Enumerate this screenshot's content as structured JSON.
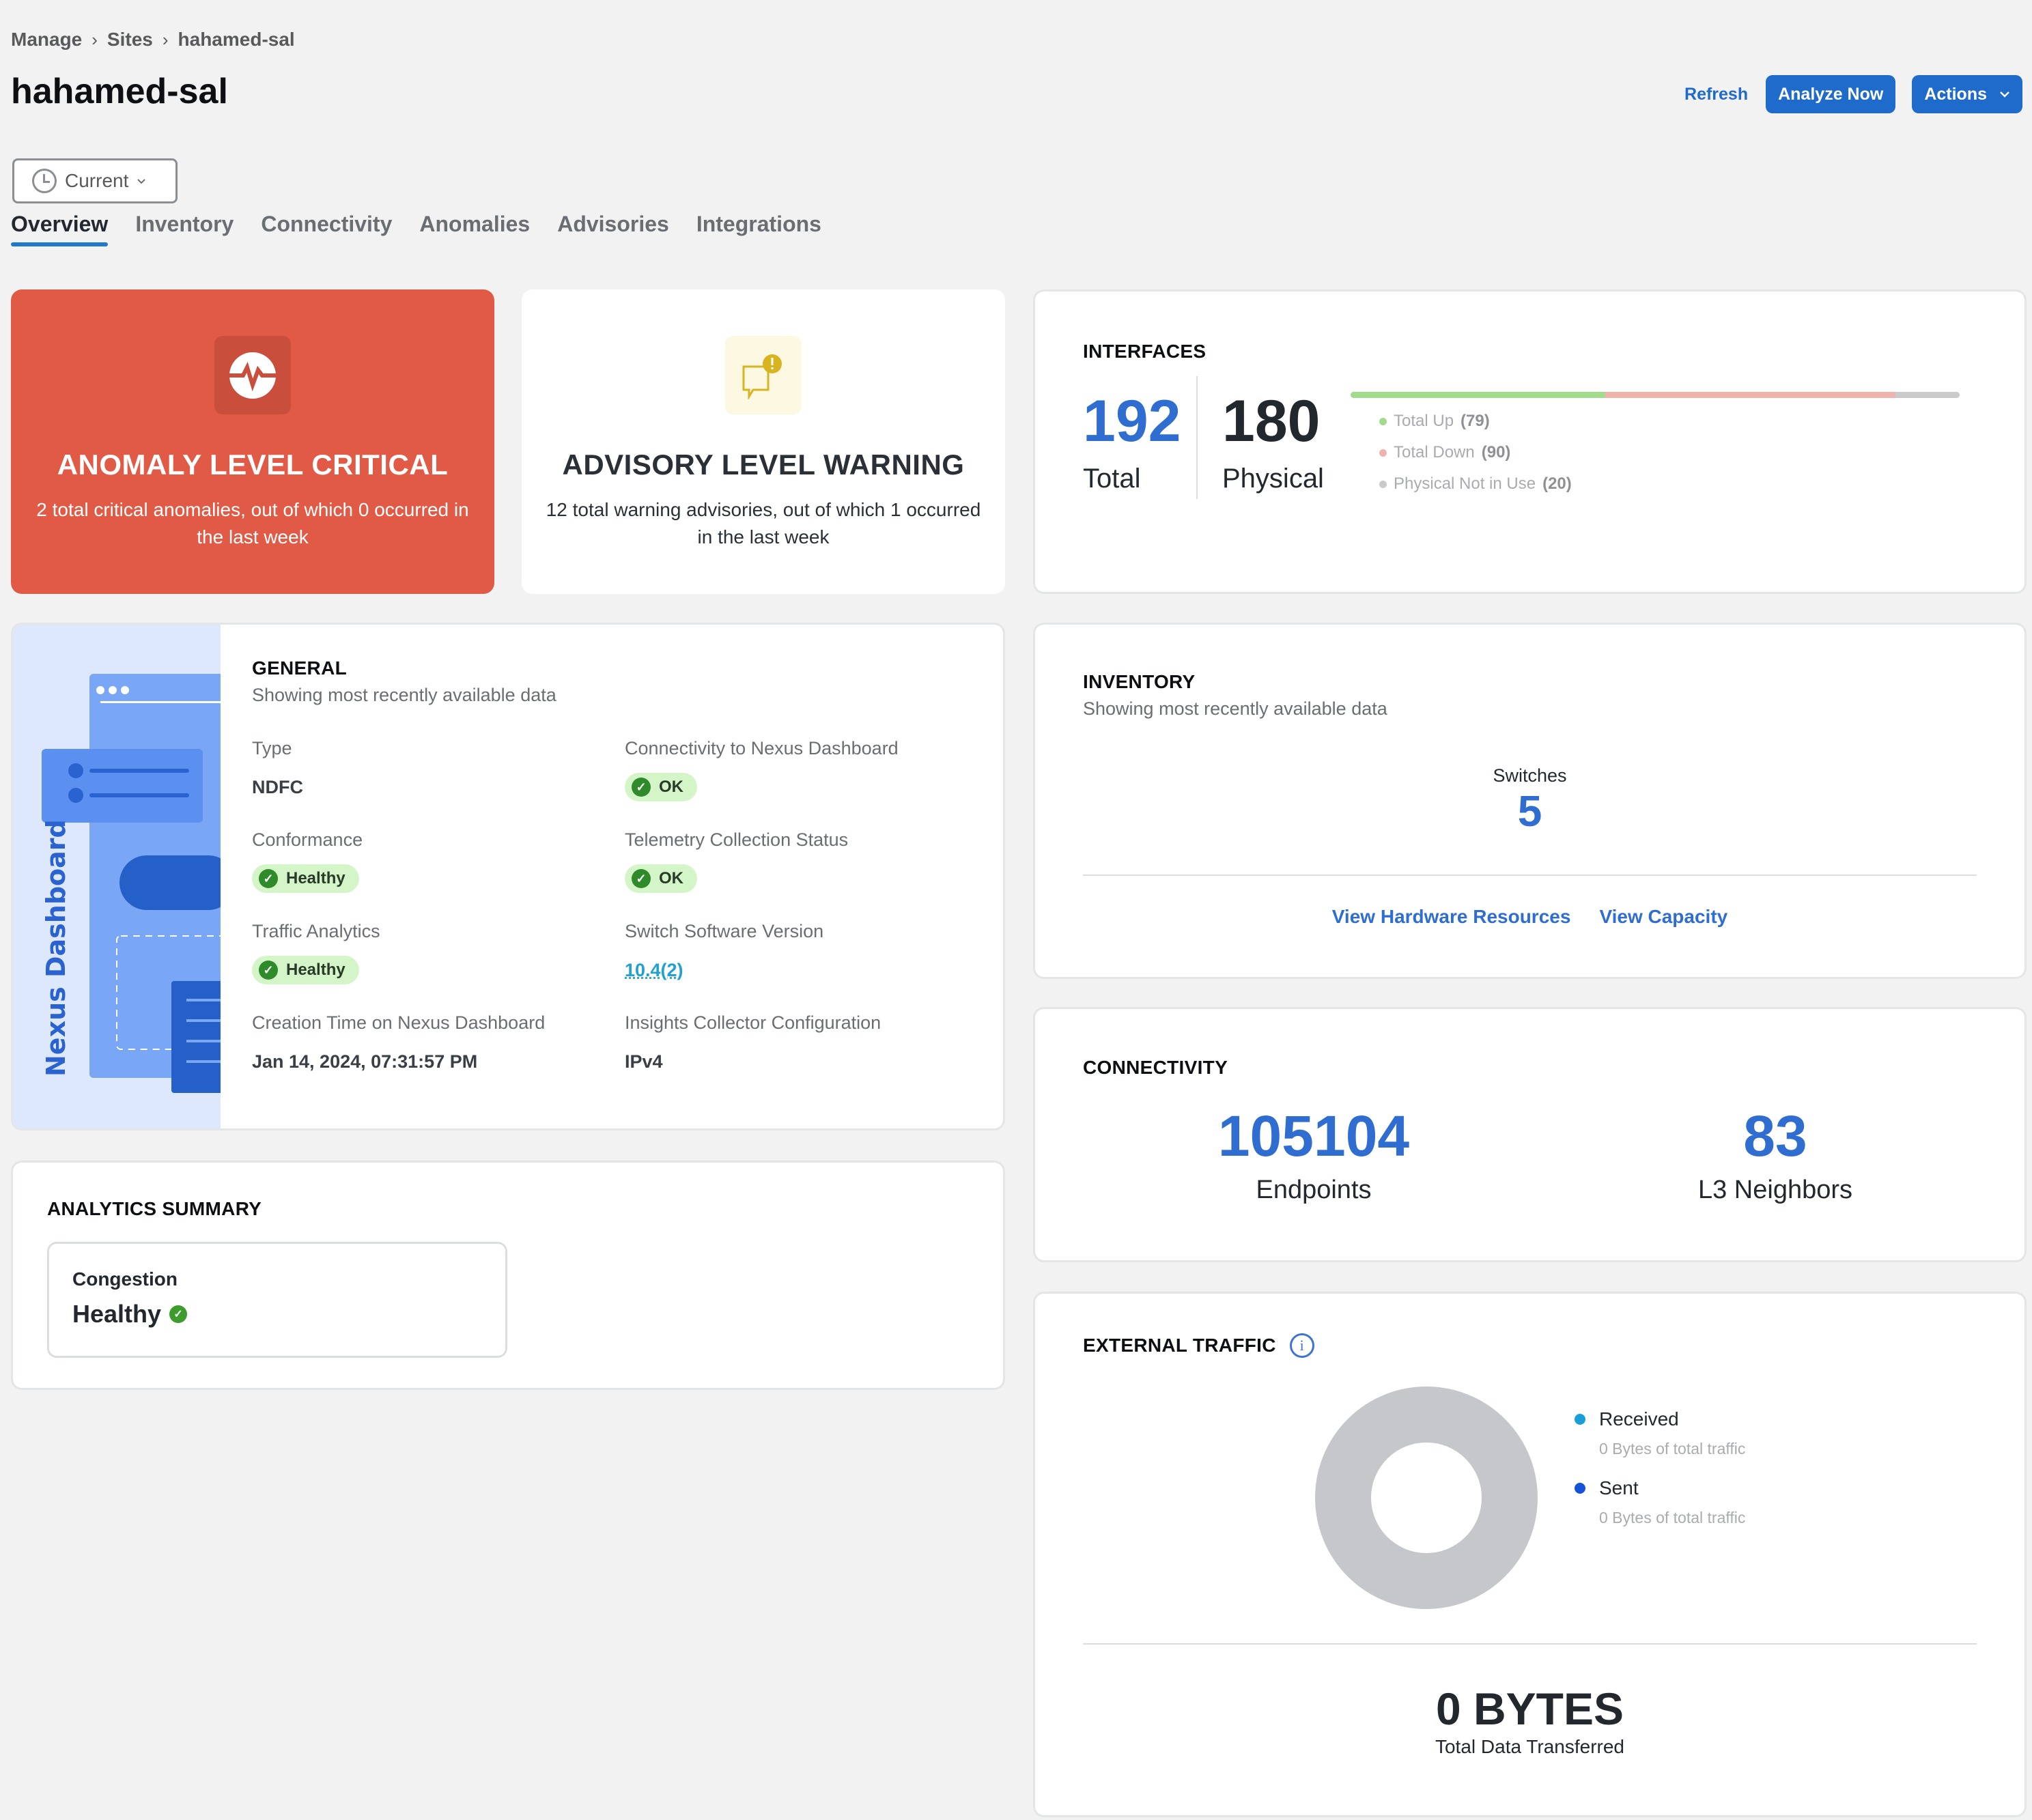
{
  "breadcrumb": [
    "Manage",
    "Sites",
    "hahamed-sal"
  ],
  "breadcrumb_separator": "›",
  "page_title": "hahamed-sal",
  "header_actions": {
    "refresh_label": "Refresh",
    "analyze_label": "Analyze Now",
    "actions_label": "Actions"
  },
  "time_selector": {
    "value": "Current",
    "icon": "clock-icon"
  },
  "tabs": [
    {
      "label": "Overview",
      "active": true
    },
    {
      "label": "Inventory",
      "active": false
    },
    {
      "label": "Connectivity",
      "active": false
    },
    {
      "label": "Anomalies",
      "active": false
    },
    {
      "label": "Advisories",
      "active": false
    },
    {
      "label": "Integrations",
      "active": false
    }
  ],
  "anomaly": {
    "icon": "pulse-icon",
    "title": "ANOMALY LEVEL CRITICAL",
    "description": "2 total critical anomalies, out of which 0 occurred in the last week",
    "color": "#e05a45"
  },
  "advisory": {
    "icon": "warning-message-icon",
    "title": "ADVISORY LEVEL WARNING",
    "description": "12 total warning advisories, out of which 1 occurred in the last week",
    "color": "#d8b421"
  },
  "interfaces": {
    "title": "INTERFACES",
    "total": {
      "value": "192",
      "label": "Total"
    },
    "physical": {
      "value": "180",
      "label": "Physical"
    },
    "breakdown": [
      {
        "label": "Total Up",
        "count": 79,
        "count_text": "(79)",
        "color": "#a3db8c"
      },
      {
        "label": "Total Down",
        "count": 90,
        "count_text": "(90)",
        "color": "#efb3ad"
      },
      {
        "label": "Physical Not in Use",
        "count": 20,
        "count_text": "(20)",
        "color": "#cacaca"
      }
    ]
  },
  "general": {
    "title": "GENERAL",
    "subtitle": "Showing most recently available data",
    "illustration_label": "Nexus Dashboard",
    "fields": {
      "type": {
        "label": "Type",
        "value": "NDFC"
      },
      "connectivity": {
        "label": "Connectivity to Nexus Dashboard",
        "value": "OK"
      },
      "conformance": {
        "label": "Conformance",
        "value": "Healthy"
      },
      "telemetry": {
        "label": "Telemetry Collection Status",
        "value": "OK"
      },
      "traffic_analytics": {
        "label": "Traffic Analytics",
        "value": "Healthy"
      },
      "software_version": {
        "label": "Switch Software Version",
        "value": "10.4(2)"
      },
      "creation_time": {
        "label": "Creation Time on Nexus Dashboard",
        "value": "Jan 14, 2024, 07:31:57 PM"
      },
      "collector_config": {
        "label": "Insights Collector Configuration",
        "value": "IPv4"
      }
    }
  },
  "inventory": {
    "title": "INVENTORY",
    "subtitle": "Showing most recently available data",
    "switches_label": "Switches",
    "switches_value": "5",
    "links": {
      "hardware": "View Hardware Resources",
      "capacity": "View Capacity"
    }
  },
  "connectivity": {
    "title": "CONNECTIVITY",
    "endpoints": {
      "value": "105104",
      "label": "Endpoints"
    },
    "l3_neighbors": {
      "value": "83",
      "label": "L3 Neighbors"
    }
  },
  "analytics_summary": {
    "title": "ANALYTICS SUMMARY",
    "congestion_label": "Congestion",
    "congestion_value": "Healthy"
  },
  "external_traffic": {
    "title": "EXTERNAL TRAFFIC",
    "received": {
      "label": "Received",
      "detail": "0 Bytes of total traffic",
      "bytes": 0,
      "color": "#1a9ed9"
    },
    "sent": {
      "label": "Sent",
      "detail": "0 Bytes of total traffic",
      "bytes": 0,
      "color": "#1553d6"
    },
    "empty_color": "#c6c7ca",
    "total_value": "0 BYTES",
    "total_label": "Total Data Transferred"
  }
}
